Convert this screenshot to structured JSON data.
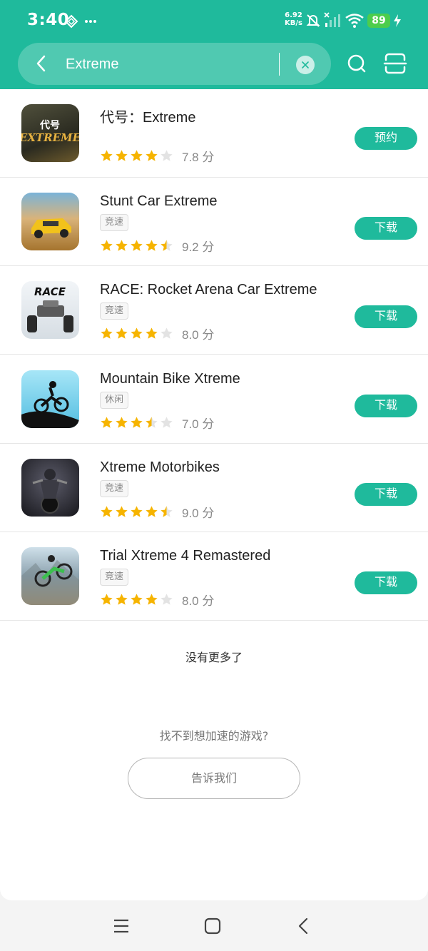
{
  "status_bar": {
    "time": "3:40",
    "net_speed_value": "6.92",
    "net_speed_unit": "KB/s",
    "battery": "89"
  },
  "search": {
    "value": "Extreme"
  },
  "results": [
    {
      "title": "代号：Extreme",
      "tag": "",
      "stars": 4,
      "score": "7.8 分",
      "action": "预约",
      "thumb_color": "#3a3a2a"
    },
    {
      "title": "Stunt Car Extreme",
      "tag": "竞速",
      "stars": 4.5,
      "score": "9.2 分",
      "action": "下载",
      "thumb_color": "#b98a3c"
    },
    {
      "title": "RACE: Rocket Arena Car Extreme",
      "tag": "竞速",
      "stars": 4,
      "score": "8.0 分",
      "action": "下载",
      "thumb_color": "#e9eef3"
    },
    {
      "title": "Mountain Bike Xtreme",
      "tag": "休闲",
      "stars": 3.5,
      "score": "7.0 分",
      "action": "下载",
      "thumb_color": "#7fd3f0"
    },
    {
      "title": "Xtreme Motorbikes",
      "tag": "竞速",
      "stars": 4.5,
      "score": "9.0 分",
      "action": "下载",
      "thumb_color": "#2b2b33"
    },
    {
      "title": "Trial Xtreme 4 Remastered",
      "tag": "竞速",
      "stars": 4,
      "score": "8.0 分",
      "action": "下载",
      "thumb_color": "#8aa6b8"
    }
  ],
  "footer": {
    "end_text": "没有更多了",
    "ask_text": "找不到想加速的游戏?",
    "tell_button": "告诉我们"
  },
  "colors": {
    "accent": "#1fba9c",
    "star": "#f6b400",
    "star_empty": "#e3e3e3"
  },
  "icons": [
    "back-icon",
    "clear-icon",
    "search-icon",
    "scan-icon",
    "menu-icon",
    "home-icon",
    "nav-back-icon"
  ]
}
